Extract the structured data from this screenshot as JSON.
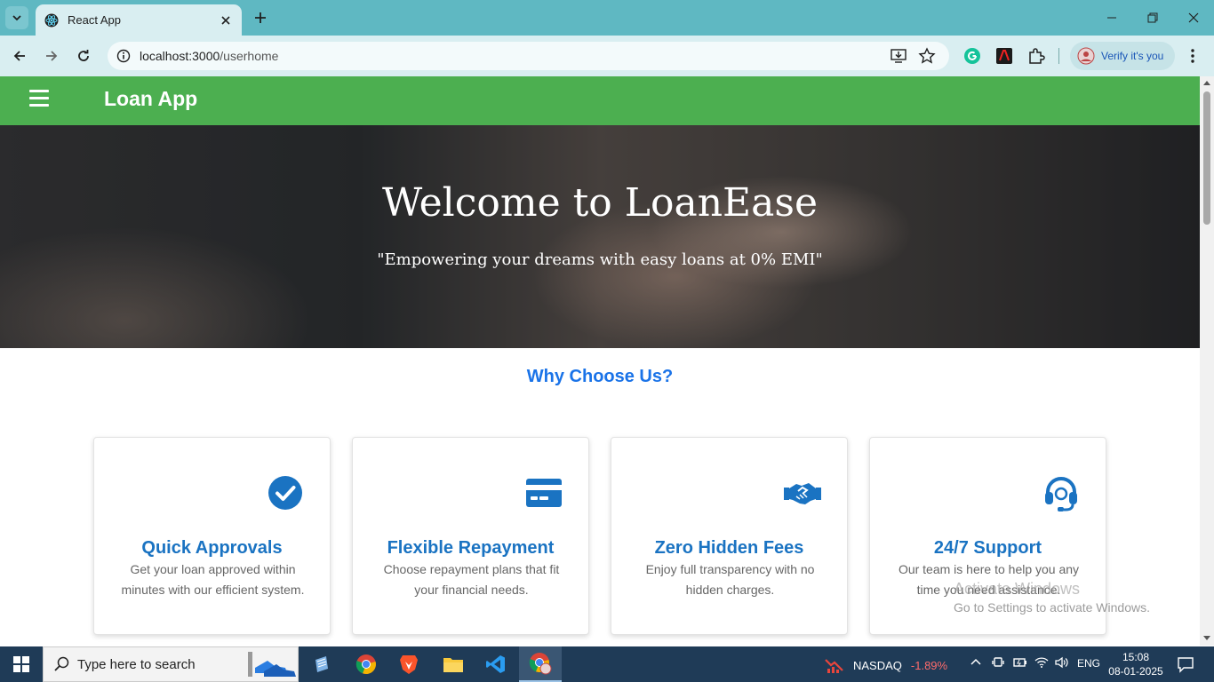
{
  "browser": {
    "tab_title": "React App",
    "url_host": "localhost:3000",
    "url_path": "/userhome",
    "profile_label": "Verify it's you"
  },
  "navbar": {
    "brand": "Loan App"
  },
  "hero": {
    "title": "Welcome to LoanEase",
    "subtitle": "\"Empowering your dreams with easy loans at 0% EMI\""
  },
  "features": {
    "heading": "Why Choose Us?",
    "items": [
      {
        "icon": "check-circle-icon",
        "title": "Quick Approvals",
        "desc": "Get your loan approved within minutes with our efficient system."
      },
      {
        "icon": "credit-card-icon",
        "title": "Flexible Repayment",
        "desc": "Choose repayment plans that fit your financial needs."
      },
      {
        "icon": "handshake-icon",
        "title": "Zero Hidden Fees",
        "desc": "Enjoy full transparency with no hidden charges."
      },
      {
        "icon": "headset-icon",
        "title": "24/7 Support",
        "desc": "Our team is here to help you any time you need assistance."
      }
    ]
  },
  "watermark": {
    "line1": "Activate Windows",
    "line2": "Go to Settings to activate Windows."
  },
  "taskbar": {
    "search_placeholder": "Type here to search",
    "ticker_name": "NASDAQ",
    "ticker_change": "-1.89%",
    "language": "ENG",
    "time": "15:08",
    "date": "08-01-2025"
  },
  "colors": {
    "navbar": "#4caf50",
    "accent_blue": "#1a73e8",
    "card_title": "#1a73c2"
  }
}
